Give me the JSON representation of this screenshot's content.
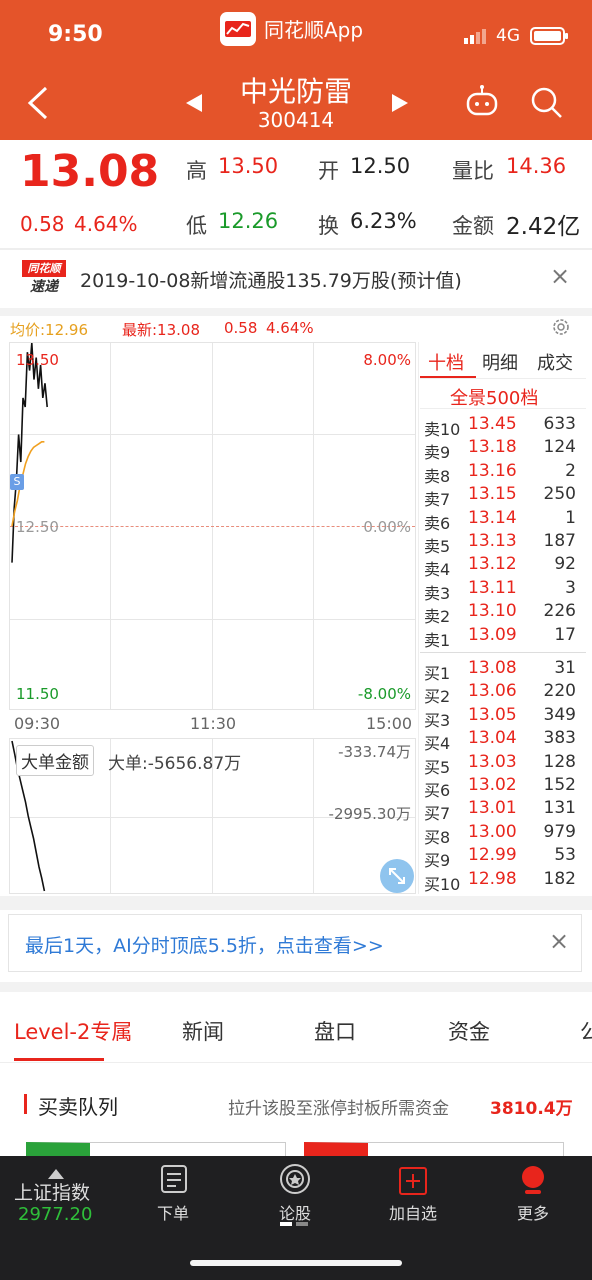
{
  "status_bar": {
    "time": "9:50",
    "app_name": "同花顺App",
    "network": "4G"
  },
  "header": {
    "stock_name": "中光防雷",
    "stock_code": "300414"
  },
  "quote": {
    "price": "13.08",
    "change": "0.58",
    "change_pct": "4.64%",
    "high_label": "高",
    "high": "13.50",
    "open_label": "开",
    "open": "12.50",
    "ratio_label": "量比",
    "ratio": "14.36",
    "low_label": "低",
    "low": "12.26",
    "turnover_label": "换",
    "turnover": "6.23%",
    "amount_label": "金额",
    "amount": "2.42亿"
  },
  "news": {
    "logo_top": "同花顺",
    "logo_bottom": "速递",
    "text": "2019-10-08新增流通股135.79万股(预计值)",
    "close": "×"
  },
  "chart_header": {
    "avg_label": "均价:12.96",
    "latest_label": "最新:13.08",
    "change": "0.58",
    "change_pct": "4.64%"
  },
  "chart_data": {
    "type": "line",
    "y_top": "13.50",
    "y_mid": "12.50",
    "y_bottom": "11.50",
    "pct_top": "8.00%",
    "pct_mid": "0.00%",
    "pct_bottom": "-8.00%",
    "x_labels": [
      "09:30",
      "11:30",
      "15:00"
    ],
    "ylim": [
      11.5,
      13.5
    ],
    "price_series": [
      12.3,
      12.6,
      12.75,
      13.0,
      12.85,
      13.2,
      13.15,
      13.45,
      13.35,
      13.5,
      13.3,
      13.42,
      13.25,
      13.38,
      13.2,
      13.28,
      13.15
    ],
    "avg_series": [
      12.5,
      12.58,
      12.64,
      12.72,
      12.78,
      12.84,
      12.88,
      12.91,
      12.93,
      12.94,
      12.95,
      12.96,
      12.96
    ],
    "marker": "S",
    "volume_label": "大单金额",
    "volume_value": "大单:-5656.87万",
    "volume_top": "-333.74万",
    "volume_mid": "-2995.30万",
    "volume_series": [
      -333.74,
      -800,
      -1300,
      -1700,
      -2100,
      -2500,
      -2995.3,
      -3400,
      -3800,
      -4300,
      -4800,
      -5200,
      -5656.87
    ]
  },
  "order_book": {
    "tabs": [
      "十档",
      "明细",
      "成交"
    ],
    "full_label": "全景500档",
    "sells": [
      {
        "label": "卖10",
        "price": "13.45",
        "vol": "633"
      },
      {
        "label": "卖9",
        "price": "13.18",
        "vol": "124"
      },
      {
        "label": "卖8",
        "price": "13.16",
        "vol": "2"
      },
      {
        "label": "卖7",
        "price": "13.15",
        "vol": "250"
      },
      {
        "label": "卖6",
        "price": "13.14",
        "vol": "1"
      },
      {
        "label": "卖5",
        "price": "13.13",
        "vol": "187"
      },
      {
        "label": "卖4",
        "price": "13.12",
        "vol": "92"
      },
      {
        "label": "卖3",
        "price": "13.11",
        "vol": "3"
      },
      {
        "label": "卖2",
        "price": "13.10",
        "vol": "226"
      },
      {
        "label": "卖1",
        "price": "13.09",
        "vol": "17"
      }
    ],
    "buys": [
      {
        "label": "买1",
        "price": "13.08",
        "vol": "31"
      },
      {
        "label": "买2",
        "price": "13.06",
        "vol": "220"
      },
      {
        "label": "买3",
        "price": "13.05",
        "vol": "349"
      },
      {
        "label": "买4",
        "price": "13.04",
        "vol": "383"
      },
      {
        "label": "买5",
        "price": "13.03",
        "vol": "128"
      },
      {
        "label": "买6",
        "price": "13.02",
        "vol": "152"
      },
      {
        "label": "买7",
        "price": "13.01",
        "vol": "131"
      },
      {
        "label": "买8",
        "price": "13.00",
        "vol": "979"
      },
      {
        "label": "买9",
        "price": "12.99",
        "vol": "53"
      },
      {
        "label": "买10",
        "price": "12.98",
        "vol": "182"
      }
    ]
  },
  "ai_banner": {
    "text": "最后1天，AI分时顶底5.5折，点击查看>>",
    "close": "×"
  },
  "section_tabs": [
    "Level-2专属",
    "新闻",
    "盘口",
    "资金",
    "公"
  ],
  "queue": {
    "title": "买卖队列",
    "desc": "拉升该股至涨停封板所需资金",
    "amount": "3810.4万"
  },
  "bottom_nav": {
    "index_name": "上证指数",
    "index_value": "2977.20",
    "items": [
      "下单",
      "论股",
      "加自选",
      "更多"
    ]
  }
}
